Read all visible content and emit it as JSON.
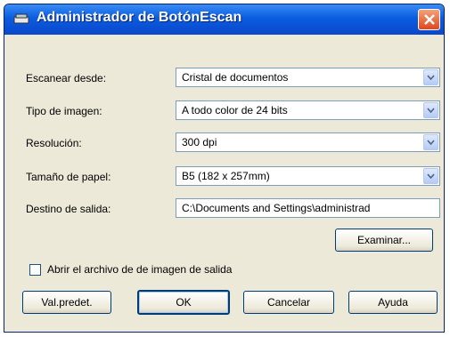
{
  "window": {
    "title": "Administrador de BotónEscan"
  },
  "fields": {
    "scan_from": {
      "label": "Escanear desde:",
      "value": "Cristal de documentos"
    },
    "image_type": {
      "label": "Tipo de imagen:",
      "value": "A todo color de 24 bits"
    },
    "resolution": {
      "label": "Resolución:",
      "value": "300 dpi"
    },
    "paper_size": {
      "label": "Tamaño de papel:",
      "value": "B5 (182 x 257mm)"
    },
    "output_dest": {
      "label": "Destino de salida:",
      "value": "C:\\Documents and Settings\\administrad"
    }
  },
  "buttons": {
    "browse": "Examinar...",
    "defaults": "Val.predet.",
    "ok": "OK",
    "cancel": "Cancelar",
    "help": "Ayuda"
  },
  "checkbox": {
    "label": "Abrir el archivo de de imagen de salida",
    "checked": false
  },
  "colors": {
    "titlebar": "#0a5ce0",
    "dialog_bg": "#ece9d8",
    "close_button": "#e0461b"
  }
}
